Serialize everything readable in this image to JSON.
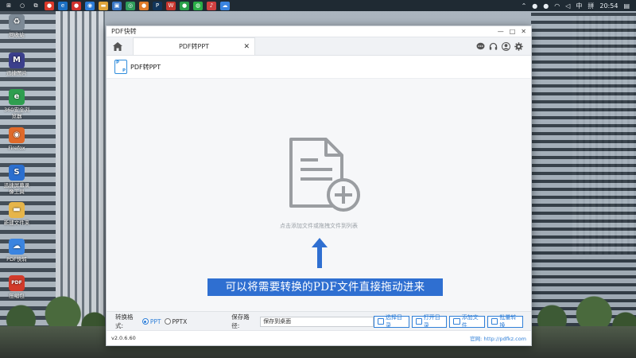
{
  "taskbar": {
    "apps": [
      {
        "icon": "start-icon",
        "color": "#1f2a33",
        "glyph": "⊞"
      },
      {
        "icon": "search-icon",
        "color": "#1f2a33",
        "glyph": "○"
      },
      {
        "icon": "taskview-icon",
        "color": "#1f2a33",
        "glyph": "⧉"
      },
      {
        "icon": "app-red-icon",
        "color": "#d93a2b",
        "glyph": "●"
      },
      {
        "icon": "app-edge-icon",
        "color": "#1c6fc2",
        "glyph": "e"
      },
      {
        "icon": "app-baidu-icon",
        "color": "#d0312d",
        "glyph": "●"
      },
      {
        "icon": "app-browser-icon",
        "color": "#2b7bd6",
        "glyph": "◉"
      },
      {
        "icon": "app-folder-icon",
        "color": "#e0a43a",
        "glyph": "▬"
      },
      {
        "icon": "app-store-icon",
        "color": "#3a76c4",
        "glyph": "▣"
      },
      {
        "icon": "app-chrome-icon",
        "color": "#2e9d5b",
        "glyph": "◎"
      },
      {
        "icon": "app-orange-icon",
        "color": "#e07b2a",
        "glyph": "●"
      },
      {
        "icon": "app-ps-icon",
        "color": "#12355a",
        "glyph": "P"
      },
      {
        "icon": "app-wps-icon",
        "color": "#c7362e",
        "glyph": "W"
      },
      {
        "icon": "app-green-icon",
        "color": "#2aa04a",
        "glyph": "●"
      },
      {
        "icon": "app-wechat-icon",
        "color": "#2aae46",
        "glyph": "◍"
      },
      {
        "icon": "app-music-icon",
        "color": "#d04040",
        "glyph": "♪"
      },
      {
        "icon": "app-pdfkz-icon",
        "color": "#3a84e0",
        "glyph": "☁"
      }
    ],
    "tray": {
      "ime": "中",
      "lang": "拼",
      "time": "20:54",
      "notify": "通知"
    }
  },
  "desktop_icons": [
    {
      "label": "回收站",
      "color": "#7d8a96",
      "glyph": "♻"
    },
    {
      "label": "迅捷图片",
      "color": "#3b3f8c",
      "glyph": "M"
    },
    {
      "label": "360安全浏览器",
      "color": "#2e9e4f",
      "glyph": "e"
    },
    {
      "label": "Firefox",
      "color": "#e06a2a",
      "glyph": "◉"
    },
    {
      "label": "迅捷屏幕录像工具",
      "color": "#2b6fcf",
      "glyph": "S"
    },
    {
      "label": "新建文件夹",
      "color": "#e6b54a",
      "glyph": "▬"
    },
    {
      "label": "PDF快转",
      "color": "#3a84e0",
      "glyph": "☁"
    },
    {
      "label": "压缩包",
      "color": "#d23a2a",
      "glyph": "PDF"
    }
  ],
  "window": {
    "title": "PDF快转",
    "controls": {
      "minimize": "—",
      "maximize": "□",
      "close": "✕"
    },
    "tab_label": "PDF转PPT",
    "tab_close": "✕",
    "subheader": "PDF转PPT",
    "pdf_icon_letters": {
      "top": "P",
      "bottom": "P"
    },
    "dropzone_hint": "点击添加文件或拖拽文件到列表",
    "banner": "可以将需要转换的PDF文件直接拖动进来",
    "format_label": "转换格式:",
    "formats": [
      {
        "label": "PPT",
        "selected": true
      },
      {
        "label": "PPTX",
        "selected": false
      }
    ],
    "path_label": "保存路径:",
    "path_value": "保存到桌面",
    "buttons": [
      "选择目录",
      "打开目录",
      "添加文件",
      "批量转换"
    ],
    "version": "v2.0.6.60",
    "website_label": "官网:",
    "website": "http://pdfkz.com"
  },
  "colors": {
    "accent": "#2f7fd8",
    "banner": "#2f6fd1",
    "arrow": "#2f6fd1"
  }
}
